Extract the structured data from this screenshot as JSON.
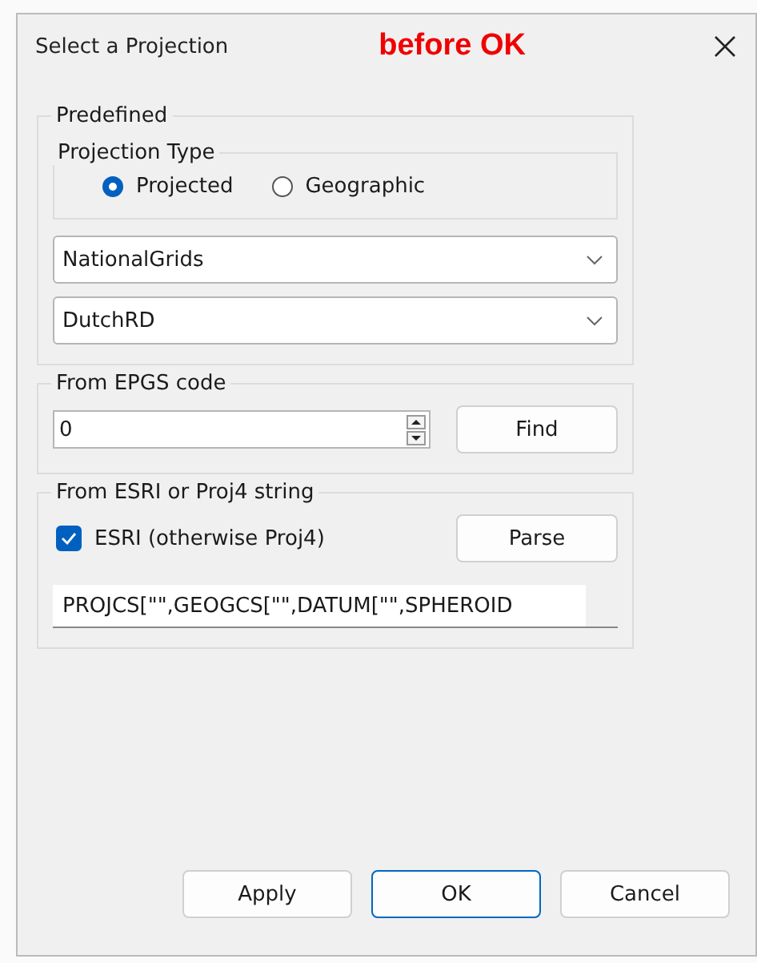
{
  "window": {
    "title": "Select a Projection",
    "annotation": "before OK"
  },
  "predefined": {
    "title": "Predefined",
    "projection_type": {
      "title": "Projection Type",
      "options": [
        {
          "label": "Projected",
          "selected": true
        },
        {
          "label": "Geographic",
          "selected": false
        }
      ]
    },
    "dropdowns": [
      {
        "value": "NationalGrids"
      },
      {
        "value": "DutchRD"
      }
    ]
  },
  "epsg": {
    "title": "From EPGS code",
    "value": "0",
    "button": "Find"
  },
  "esri": {
    "title": "From ESRI or Proj4 string",
    "checkbox": {
      "label": "ESRI (otherwise Proj4)",
      "checked": true
    },
    "button": "Parse",
    "value": "PROJCS[\"\",GEOGCS[\"\",DATUM[\"\",SPHEROID"
  },
  "buttons": [
    {
      "label": "Apply",
      "default": false
    },
    {
      "label": "OK",
      "default": true
    },
    {
      "label": "Cancel",
      "default": false
    }
  ]
}
